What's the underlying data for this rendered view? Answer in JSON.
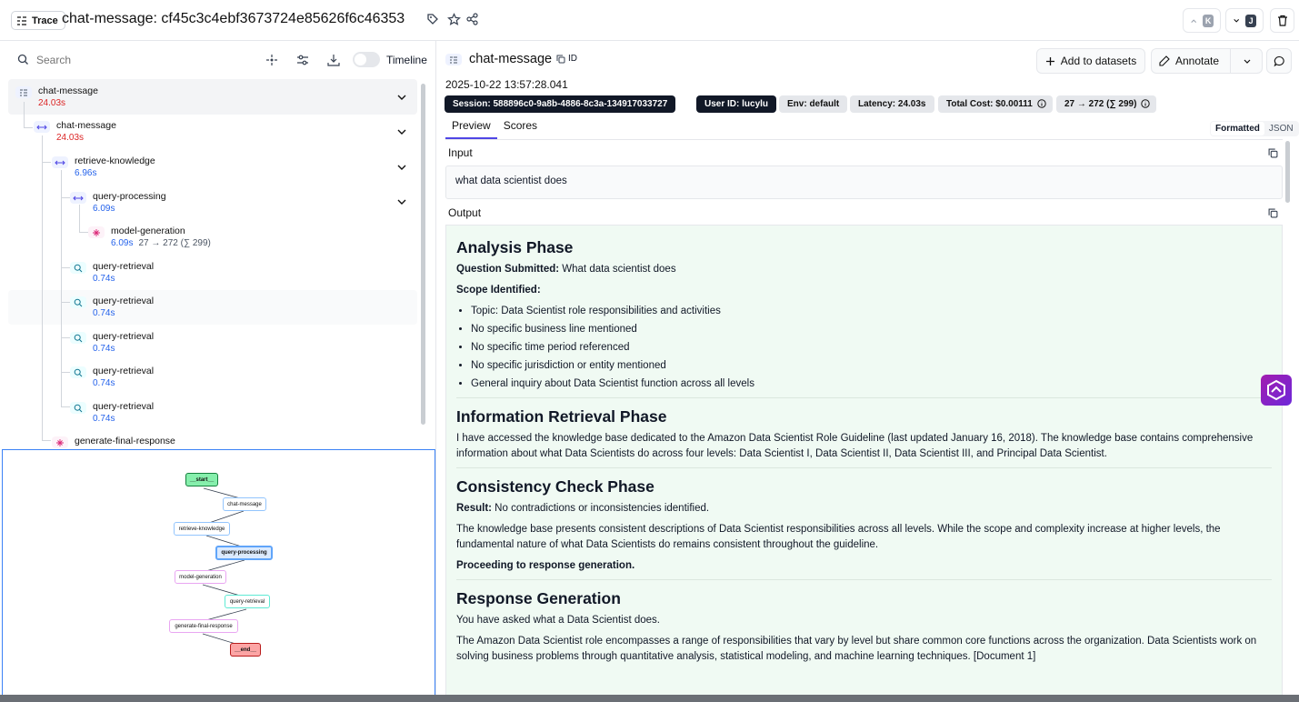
{
  "header": {
    "badge": "Trace",
    "title": "chat-message: cf45c3c4ebf3673724e85626f6c46353",
    "nav_up_key": "K",
    "nav_down_key": "J"
  },
  "left_panel": {
    "search_placeholder": "Search",
    "timeline_label": "Timeline",
    "tree": [
      {
        "name": "chat-message",
        "time": "24.03s"
      },
      {
        "name": "chat-message",
        "time": "24.03s"
      },
      {
        "name": "retrieve-knowledge",
        "time": "6.96s"
      },
      {
        "name": "query-processing",
        "time": "6.09s"
      },
      {
        "name": "model-generation",
        "time": "6.09s",
        "tokens": "27 → 272 (∑ 299)"
      },
      {
        "name": "query-retrieval",
        "time": "0.74s"
      },
      {
        "name": "query-retrieval",
        "time": "0.74s"
      },
      {
        "name": "query-retrieval",
        "time": "0.74s"
      },
      {
        "name": "query-retrieval",
        "time": "0.74s"
      },
      {
        "name": "query-retrieval",
        "time": "0.74s"
      },
      {
        "name": "generate-final-response",
        "time": ""
      }
    ],
    "graph": {
      "nodes": [
        "__start__",
        "chat-message",
        "retrieve-knowledge",
        "query-processing",
        "model-generation",
        "query-retrieval",
        "generate-final-response",
        "__end__"
      ]
    }
  },
  "detail": {
    "title": "chat-message",
    "id_label": "ID",
    "add_to_datasets": "Add to datasets",
    "annotate": "Annotate",
    "timestamp": "2025-10-22 13:57:28.041",
    "pills": {
      "session": "Session: 588896c0-9a8b-4886-8c3a-134917033727",
      "user": "User ID: lucylu",
      "env": "Env: default",
      "latency": "Latency: 24.03s",
      "cost": "Total Cost: $0.00111",
      "tokens": "27 → 272 (∑ 299)"
    },
    "tabs": [
      "Preview",
      "Scores"
    ],
    "format_options": [
      "Formatted",
      "JSON"
    ],
    "input_label": "Input",
    "input_value": "what data scientist does",
    "output_label": "Output",
    "output": {
      "h_analysis": "Analysis Phase",
      "q_label": "Question Submitted:",
      "q_value": " What data scientist does",
      "scope_label": "Scope Identified:",
      "scope_items": [
        "Topic: Data Scientist role responsibilities and activities",
        "No specific business line mentioned",
        "No specific time period referenced",
        "No specific jurisdiction or entity mentioned",
        "General inquiry about Data Scientist function across all levels"
      ],
      "h_retrieval": "Information Retrieval Phase",
      "retrieval_text": "I have accessed the knowledge base dedicated to the Amazon Data Scientist Role Guideline (last updated January 16, 2018). The knowledge base contains comprehensive information about what Data Scientists do across four levels: Data Scientist I, Data Scientist II, Data Scientist III, and Principal Data Scientist.",
      "h_consistency": "Consistency Check Phase",
      "result_label": "Result:",
      "result_value": " No contradictions or inconsistencies identified.",
      "consistency_text": "The knowledge base presents consistent descriptions of Data Scientist responsibilities across all levels. While the scope and complexity increase at higher levels, the fundamental nature of what Data Scientists do remains consistent throughout the guideline.",
      "proceeding": "Proceeding to response generation.",
      "h_response": "Response Generation",
      "response_1": "You have asked what a Data Scientist does.",
      "response_2": "The Amazon Data Scientist role encompasses a range of responsibilities that vary by level but share common core functions across the organization. Data Scientists work on solving business problems through quantitative analysis, statistical modeling, and machine learning techniques. [Document 1]"
    }
  }
}
